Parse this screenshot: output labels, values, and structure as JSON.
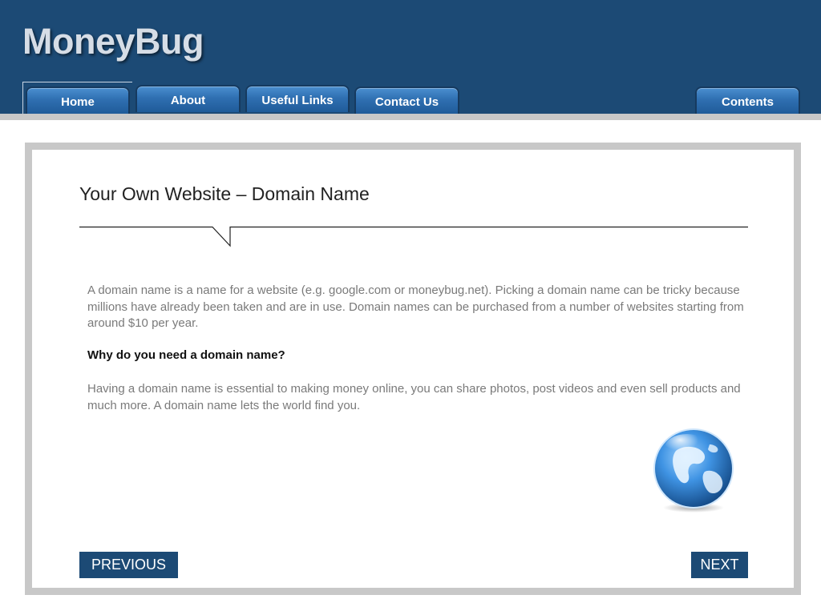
{
  "app": {
    "logo": "MoneyBug"
  },
  "nav": {
    "tabs": [
      {
        "label": "Home"
      },
      {
        "label": "About"
      },
      {
        "label": "Useful Links"
      },
      {
        "label": "Contact Us"
      }
    ],
    "contents_label": "Contents"
  },
  "main": {
    "title": "Your Own Website – Domain Name",
    "paragraph1": "A domain name is a name for a website (e.g. google.com or moneybug.net). Picking a domain name can be tricky because millions have already been taken and are in use. Domain names can be purchased from a number of websites starting from around $10 per year.",
    "subheading": "Why do you need a domain name?",
    "paragraph2": "Having a domain name is essential to making money online, you can share photos, post videos and even sell products and much more. A domain name lets the world find you."
  },
  "footer_nav": {
    "previous_label": "PREVIOUS",
    "next_label": "NEXT"
  },
  "colors": {
    "header_bg": "#1c4a75",
    "tab_blue": "#2f6fb1",
    "button_bg": "#1c4a75",
    "frame_gray": "#c8c8c8"
  },
  "icons": {
    "globe": "globe-icon"
  }
}
